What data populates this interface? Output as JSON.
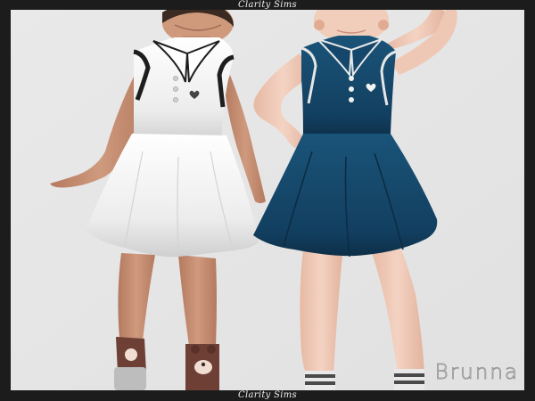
{
  "watermark_top": "Clarity Sims",
  "watermark_bottom": "Clarity Sims",
  "item_name": "Brunna",
  "colors": {
    "frame": "#1c1c1c",
    "background": "#e6e6e6",
    "dress_white": "#f1f1f1",
    "dress_navy": "#14476b",
    "trim_black": "#1e1e1e",
    "skin_light": "#ecc4b0",
    "skin_dark": "#c98e72",
    "sock_brown": "#6e3f35",
    "sock_grey": "#bcbcbc"
  }
}
